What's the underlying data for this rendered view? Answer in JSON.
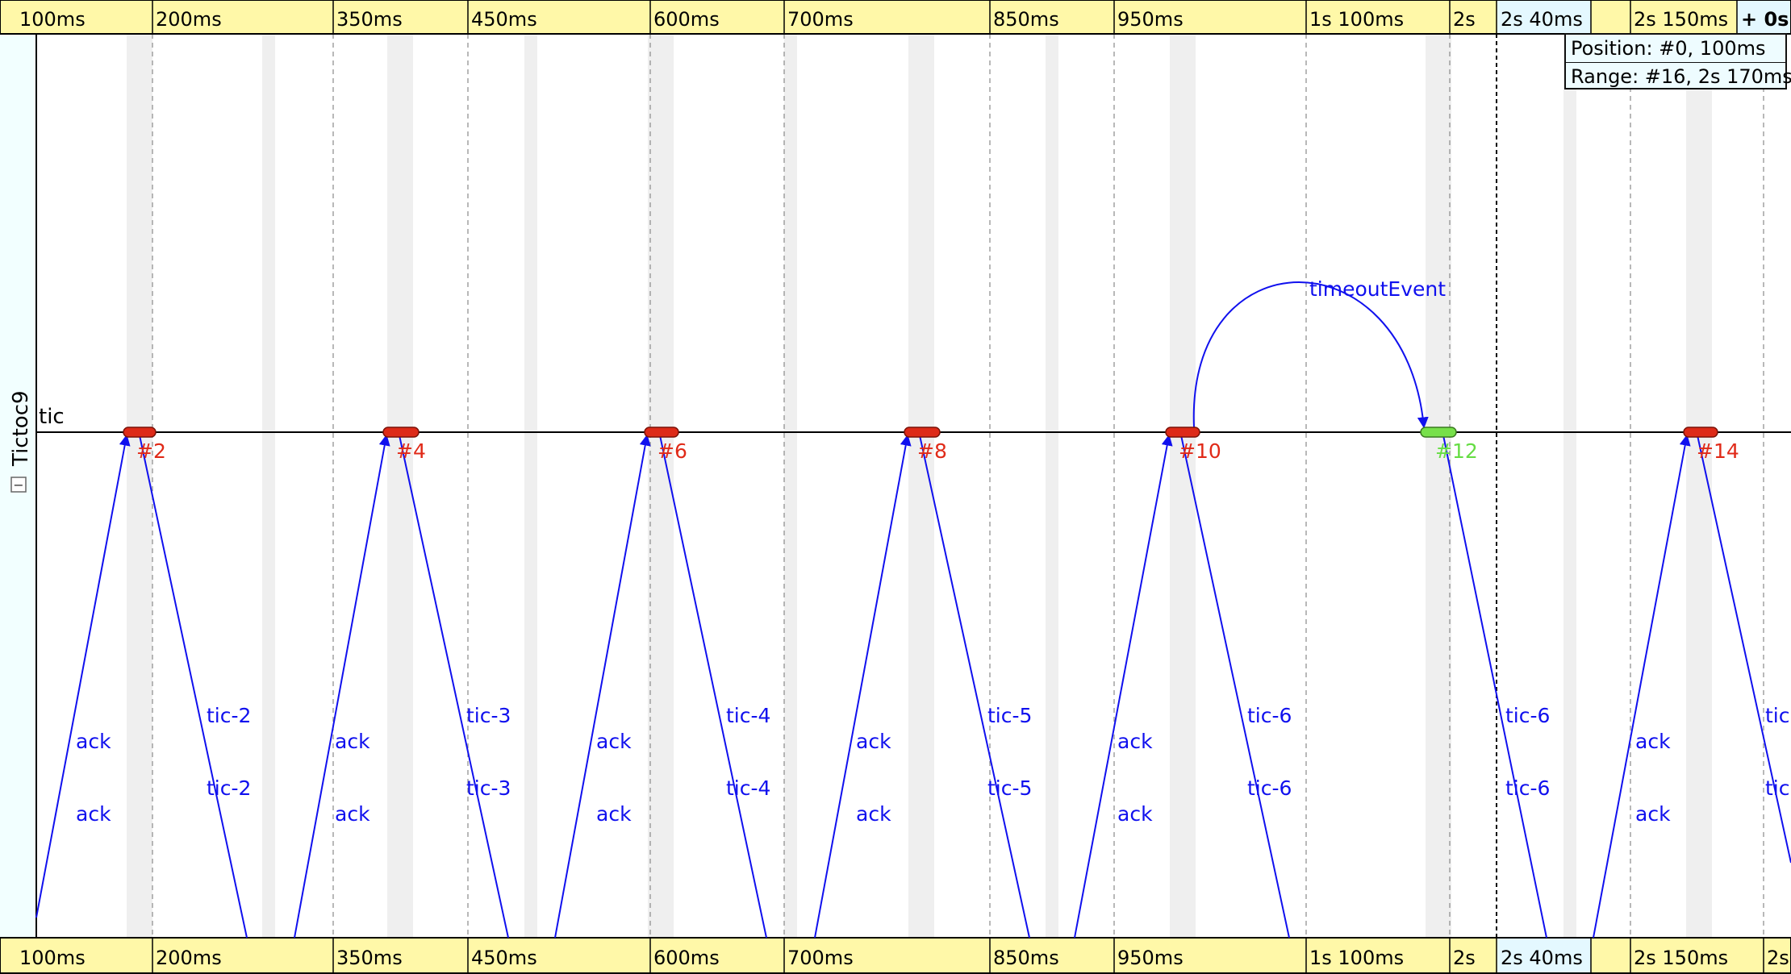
{
  "app": {
    "module_name": "Tictoc9",
    "collapse_symbol": "−",
    "axis_label": "tic"
  },
  "colors": {
    "ruler_bg": "#fff8a8",
    "ruler_highlight_bg": "#e4f8ff",
    "left_strip_bg": "#f2ffff",
    "message_arrow": "#1010ee",
    "event_red_fill": "#dd2a18",
    "event_red_text": "#e02a18",
    "event_green_fill": "#77e04a",
    "event_green_text": "#66dd44",
    "band_gray": "#efefef"
  },
  "info_box": {
    "position": "Position: #0, 100ms",
    "range": "Range: #16, 2s 170ms"
  },
  "ruler": {
    "labels": [
      "100ms",
      "200ms",
      "350ms",
      "450ms",
      "600ms",
      "700ms",
      "850ms",
      "950ms",
      "1s 100ms",
      "2s",
      "2s 40ms",
      "2s 150ms"
    ],
    "extra_label": "+ 0s",
    "bottom_partial_label": "2s"
  },
  "events": [
    {
      "label": "#2",
      "color": "red"
    },
    {
      "label": "#4",
      "color": "red"
    },
    {
      "label": "#6",
      "color": "red"
    },
    {
      "label": "#8",
      "color": "red"
    },
    {
      "label": "#10",
      "color": "red"
    },
    {
      "label": "#12",
      "color": "green"
    },
    {
      "label": "#14",
      "color": "red"
    }
  ],
  "self_message": {
    "label": "timeoutEvent"
  },
  "messages": {
    "ack_labels": [
      [
        "ack",
        "ack"
      ],
      [
        "ack",
        "ack"
      ],
      [
        "ack",
        "ack"
      ],
      [
        "ack",
        "ack"
      ],
      [
        "ack",
        "ack"
      ],
      [
        "ack",
        "ack"
      ]
    ],
    "tic_labels": [
      [
        "tic-2",
        "tic-2"
      ],
      [
        "tic-3",
        "tic-3"
      ],
      [
        "tic-4",
        "tic-4"
      ],
      [
        "tic-5",
        "tic-5"
      ],
      [
        "tic-6",
        "tic-6"
      ],
      [
        "tic-6",
        "tic-6"
      ],
      [
        "tic",
        "tic"
      ]
    ]
  }
}
